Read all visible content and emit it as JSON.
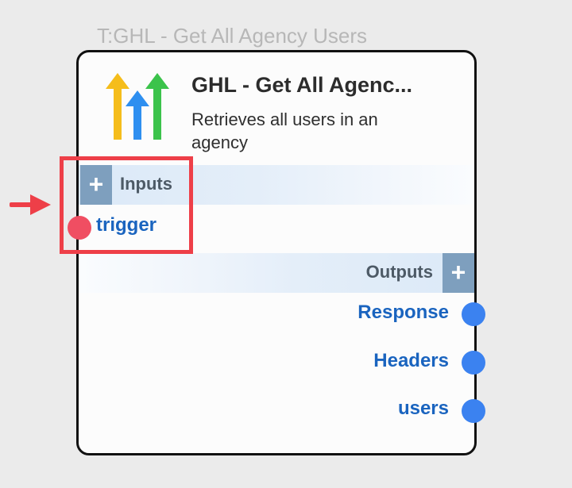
{
  "node": {
    "type_label": "T:GHL - Get All Agency Users",
    "title": "GHL - Get All Agenc...",
    "description": "Retrieves all users in an agency",
    "logo": "highlevel-arrows-logo"
  },
  "inputs": {
    "label": "Inputs",
    "add_label": "+",
    "ports": [
      {
        "label": "trigger",
        "color": "#f04e62"
      }
    ]
  },
  "outputs": {
    "label": "Outputs",
    "add_label": "+",
    "ports": [
      {
        "label": "Response",
        "color": "#3b82f0"
      },
      {
        "label": "Headers",
        "color": "#3b82f0"
      },
      {
        "label": "users",
        "color": "#3b82f0"
      }
    ]
  },
  "annotation": {
    "highlight_color": "#ee3f48",
    "arrow_icon": "arrow-right-icon"
  },
  "colors": {
    "port_label": "#1a64bf",
    "add_button": "#7e9fbe",
    "card_border": "#111111"
  }
}
